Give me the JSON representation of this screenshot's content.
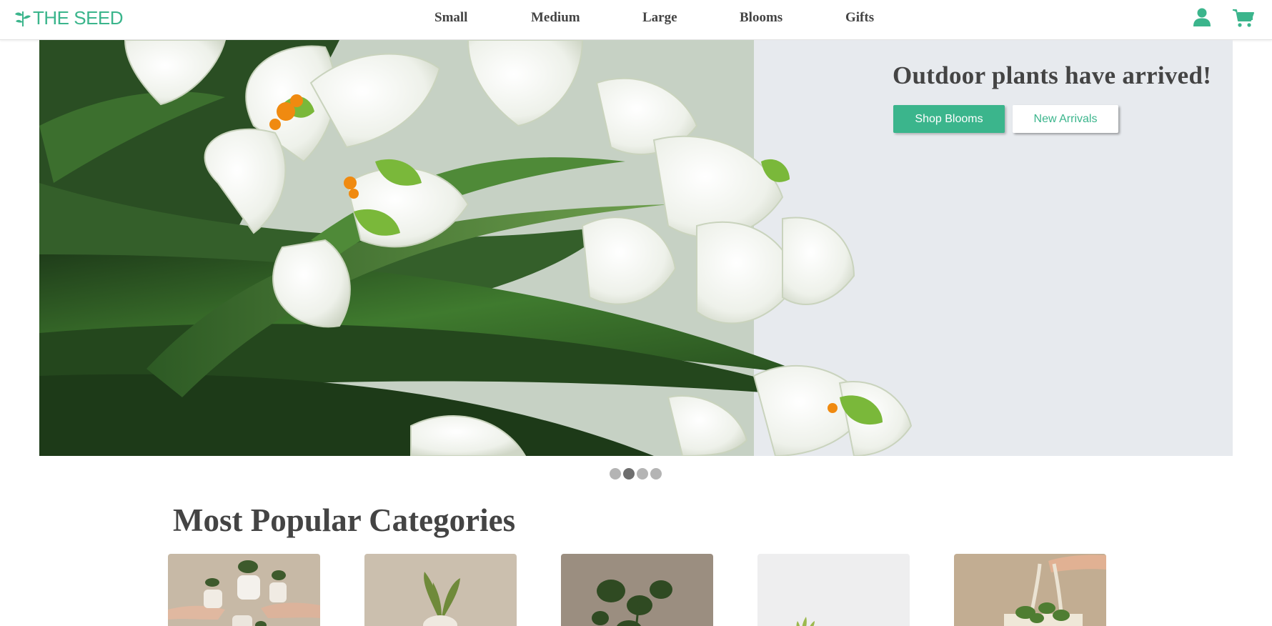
{
  "brand": {
    "name": "THE SEED",
    "accent": "#3bb58c"
  },
  "nav": {
    "items": [
      "Small",
      "Medium",
      "Large",
      "Blooms",
      "Gifts"
    ]
  },
  "header_icons": [
    "user-icon",
    "shopping-cart-icon"
  ],
  "hero": {
    "title": "Outdoor plants have arrived!",
    "primary_button": "Shop Blooms",
    "secondary_button": "New Arrivals",
    "slides": 4,
    "active_slide": 2
  },
  "categories": {
    "title": "Most Popular Categories",
    "cards": [
      {
        "name": "category-card-1",
        "bg": "#c7b9a6"
      },
      {
        "name": "category-card-2",
        "bg": "#cbbfae"
      },
      {
        "name": "category-card-3",
        "bg": "#9b8e80"
      },
      {
        "name": "category-card-4",
        "bg": "#eeeeef"
      },
      {
        "name": "category-card-5",
        "bg": "#c2ad92"
      }
    ]
  }
}
